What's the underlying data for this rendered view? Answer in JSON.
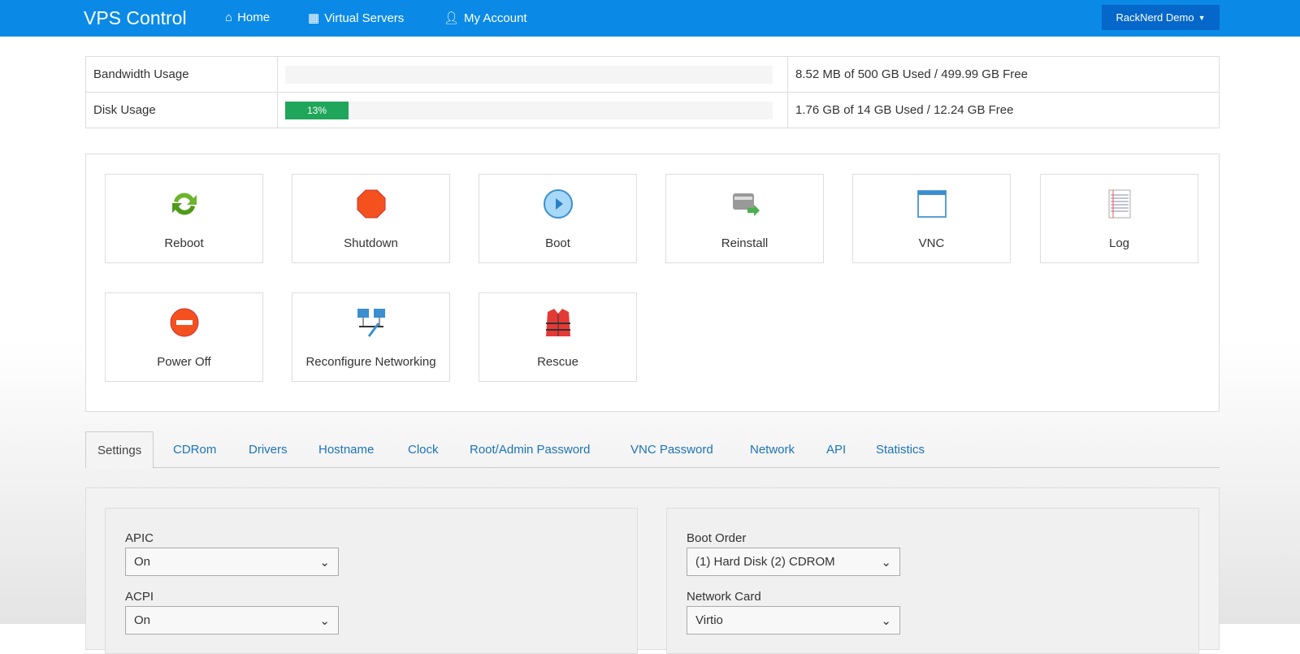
{
  "nav": {
    "brand": "VPS Control",
    "home": "Home",
    "servers": "Virtual Servers",
    "account": "My Account",
    "user_menu": "RackNerd Demo"
  },
  "usage": [
    {
      "label": "Bandwidth Usage",
      "percent": 0,
      "percent_label": "",
      "detail": "8.52 MB of 500 GB Used / 499.99 GB Free"
    },
    {
      "label": "Disk Usage",
      "percent": 13,
      "percent_label": "13%",
      "detail": "1.76 GB of 14 GB Used / 12.24 GB Free"
    }
  ],
  "actions": [
    "Reboot",
    "Shutdown",
    "Boot",
    "Reinstall",
    "VNC",
    "Log",
    "Power Off",
    "Reconfigure Networking",
    "Rescue"
  ],
  "tabs": [
    "Settings",
    "CDRom",
    "Drivers",
    "Hostname",
    "Clock",
    "Root/Admin Password",
    "VNC Password",
    "Network",
    "API",
    "Statistics"
  ],
  "settings": {
    "apic": {
      "label": "APIC",
      "value": "On"
    },
    "acpi": {
      "label": "ACPI",
      "value": "On"
    },
    "boot_order": {
      "label": "Boot Order",
      "value": "(1) Hard Disk (2) CDROM"
    },
    "network_card": {
      "label": "Network Card",
      "value": "Virtio"
    }
  }
}
